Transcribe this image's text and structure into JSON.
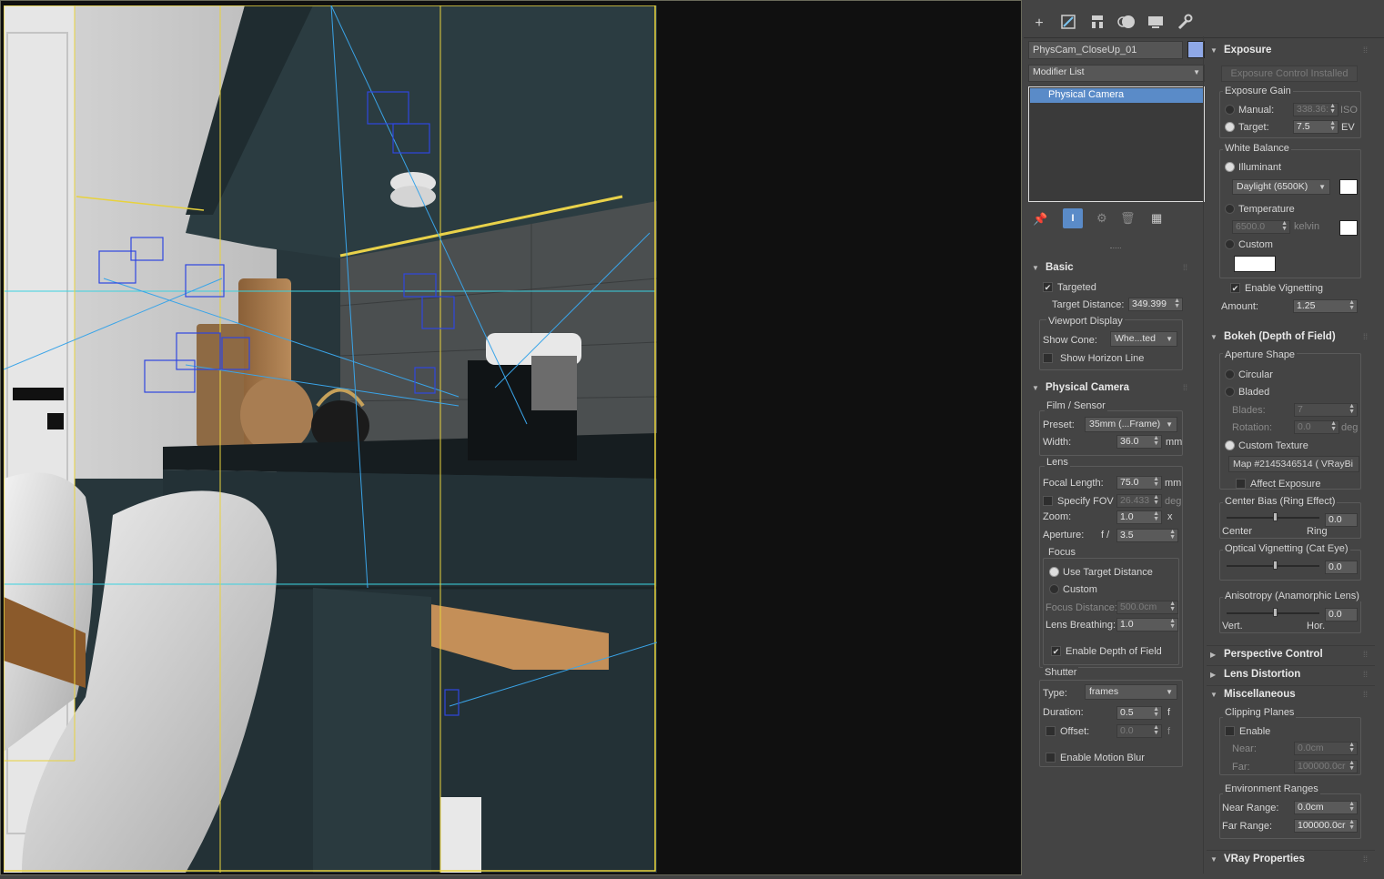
{
  "tabs": [
    "+",
    "⊡",
    "⊞",
    "●",
    "▬",
    "🔧"
  ],
  "object": {
    "name": "PhysCam_CloseUp_01",
    "color": "#8fa8e6"
  },
  "modifier": {
    "list_label": "Modifier List",
    "stack_item": "Physical Camera"
  },
  "basic": {
    "header": "Basic",
    "targeted": "Targeted",
    "target_distance_label": "Target Distance:",
    "target_distance": "349.399",
    "viewport_display": "Viewport Display",
    "show_cone_label": "Show Cone:",
    "show_cone_value": "Whe...ted",
    "show_horizon": "Show Horizon Line"
  },
  "physcam": {
    "header": "Physical Camera",
    "film_sensor": "Film / Sensor",
    "preset_label": "Preset:",
    "preset_value": "35mm (...Frame)",
    "width_label": "Width:",
    "width_value": "36.0",
    "width_unit": "mm",
    "lens": "Lens",
    "focal_label": "Focal Length:",
    "focal_value": "75.0",
    "focal_unit": "mm",
    "specify_fov": "Specify FOV",
    "fov_value": "26.433",
    "fov_unit": "deg",
    "zoom_label": "Zoom:",
    "zoom_value": "1.0",
    "zoom_unit": "x",
    "aperture_label": "Aperture:",
    "aperture_prefix": "f /",
    "aperture_value": "3.5",
    "focus": "Focus",
    "use_target": "Use Target Distance",
    "custom": "Custom",
    "focus_dist_label": "Focus Distance:",
    "focus_dist_value": "500.0cm",
    "lens_breathing_label": "Lens Breathing:",
    "lens_breathing_value": "1.0",
    "enable_dof": "Enable Depth of Field",
    "shutter": "Shutter",
    "type_label": "Type:",
    "type_value": "frames",
    "duration_label": "Duration:",
    "duration_value": "0.5",
    "duration_unit": "f",
    "offset_label": "Offset:",
    "offset_value": "0.0",
    "offset_unit": "f",
    "enable_motion_blur": "Enable Motion Blur"
  },
  "exposure": {
    "header": "Exposure",
    "installed_btn": "Exposure Control Installed",
    "gain": "Exposure Gain",
    "manual_label": "Manual:",
    "manual_value": "338.36:",
    "manual_unit": "ISO",
    "target_label": "Target:",
    "target_value": "7.5",
    "target_unit": "EV",
    "white_balance": "White Balance",
    "illuminant": "Illuminant",
    "illuminant_value": "Daylight (6500K)",
    "temperature": "Temperature",
    "temp_value": "6500.0",
    "temp_unit": "kelvin",
    "custom": "Custom",
    "enable_vignetting": "Enable Vignetting",
    "amount_label": "Amount:",
    "amount_value": "1.25"
  },
  "bokeh": {
    "header": "Bokeh (Depth of Field)",
    "aperture_shape": "Aperture Shape",
    "circular": "Circular",
    "bladed": "Bladed",
    "blades_label": "Blades:",
    "blades_value": "7",
    "rotation_label": "Rotation:",
    "rotation_value": "0.0",
    "rotation_unit": "deg",
    "custom_texture": "Custom Texture",
    "map_value": "Map #2145346514  ( VRayBi",
    "affect_exposure": "Affect Exposure",
    "center_bias": "Center Bias (Ring Effect)",
    "center_bias_value": "0.0",
    "center": "Center",
    "ring": "Ring",
    "optical_vignetting": "Optical Vignetting (Cat Eye)",
    "optical_value": "0.0",
    "anisotropy": "Anisotropy (Anamorphic Lens)",
    "anisotropy_value": "0.0",
    "vert": "Vert.",
    "hor": "Hor."
  },
  "collapsed": {
    "perspective": "Perspective Control",
    "lens_distortion": "Lens Distortion"
  },
  "misc": {
    "header": "Miscellaneous",
    "clipping_planes": "Clipping Planes",
    "enable": "Enable",
    "near_label": "Near:",
    "near_value": "0.0cm",
    "far_label": "Far:",
    "far_value": "100000.0cr",
    "env_ranges": "Environment Ranges",
    "near_range_label": "Near Range:",
    "near_range_value": "0.0cm",
    "far_range_label": "Far Range:",
    "far_range_value": "100000.0cr"
  },
  "vray": {
    "header": "VRay Properties"
  }
}
